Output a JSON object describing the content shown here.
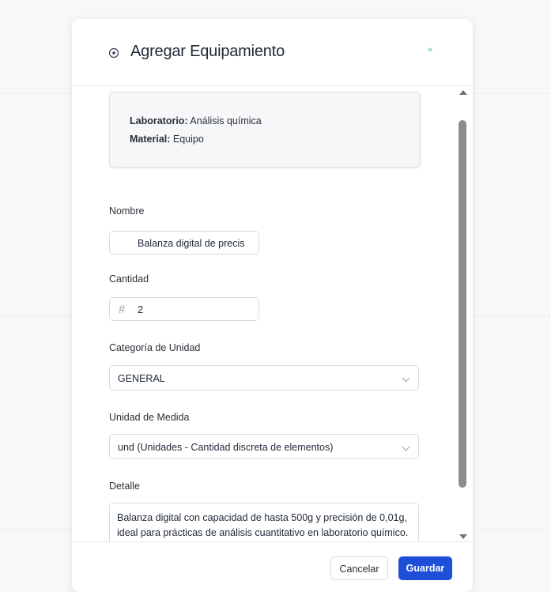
{
  "modal": {
    "title": "Agregar Equipamiento",
    "close_icon": "×",
    "header_icon": "radio-circle-icon"
  },
  "info": {
    "laboratorio_label": "Laboratorio:",
    "laboratorio_value": "Análisis química",
    "material_label": "Material:",
    "material_value": "Equipo"
  },
  "form": {
    "nombre_label": "Nombre",
    "nombre_value": "Balanza digital de precis",
    "cantidad_label": "Cantidad",
    "cantidad_icon": "#",
    "cantidad_value": "2",
    "categoria_label": "Categoría de Unidad",
    "categoria_value": "GENERAL",
    "unidad_label": "Unidad de Medida",
    "unidad_value": "und (Unidades - Cantidad discreta de elementos)",
    "detalle_label": "Detalle",
    "detalle_value": "Balanza digital con capacidad de hasta 500g y precisión de 0,01g, ideal para prácticas de análisis cuantitativo en laboratorio químico."
  },
  "footer": {
    "cancel_label": "Cancelar",
    "save_label": "Guardar"
  },
  "colors": {
    "primary": "#1d4fd8",
    "close": "#6fbfa2"
  }
}
